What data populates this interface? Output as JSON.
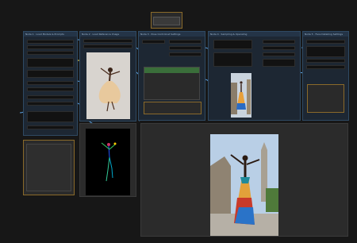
{
  "top_node": {
    "label": ""
  },
  "nodes": [
    {
      "id": "n1",
      "title": "Node 1 · Load Models & Prompts"
    },
    {
      "id": "n2",
      "title": "Node 2 · Load Reference Image"
    },
    {
      "id": "n3",
      "title": "Node 3 · Pose Controlnet Settings"
    },
    {
      "id": "n4",
      "title": "Node 4 · Sampling & Upscaling"
    },
    {
      "id": "n5",
      "title": "Node 5 · Face Detailing Settings"
    }
  ],
  "colors": {
    "bg": "#171717",
    "node_blue": "#1d2733",
    "wire": "#6ea8dd",
    "accent_orange": "#8a6a2a",
    "green": "#3a6e3a"
  }
}
